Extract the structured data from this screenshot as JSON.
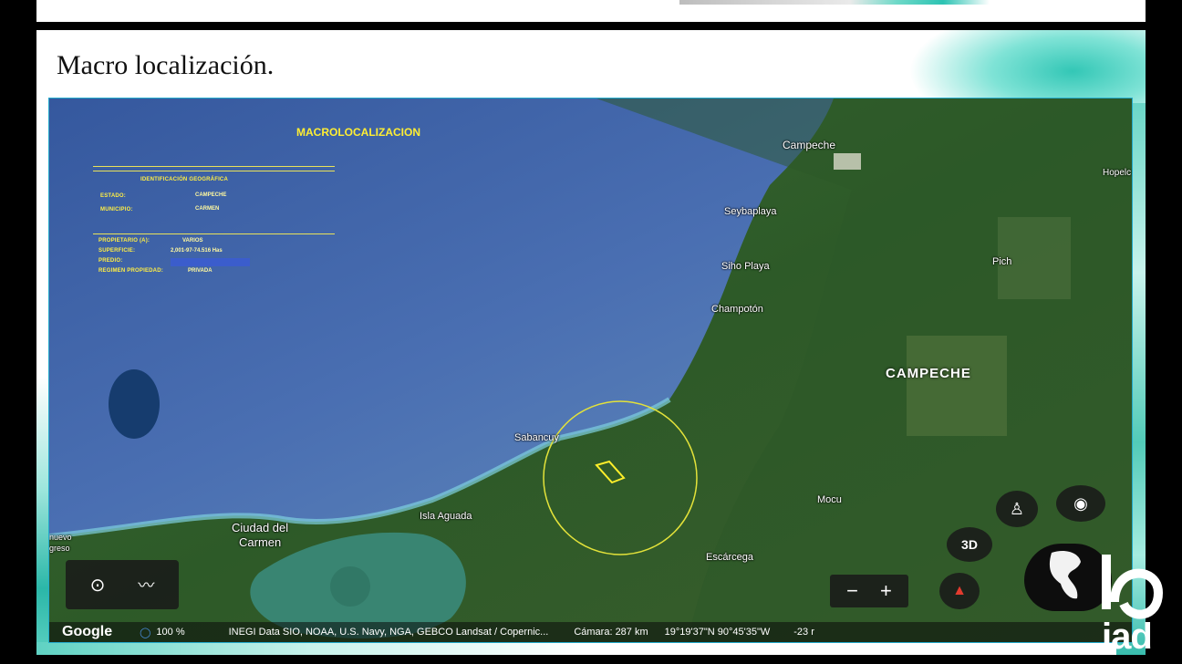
{
  "slide": {
    "title": "Macro localización."
  },
  "map": {
    "overlay": {
      "title": "MACROLOCALIZACION",
      "section": "IDENTIFICACIÓN GEOGRÁFICA",
      "estado_label": "ESTADO:",
      "estado_value": "CAMPECHE",
      "municipio_label": "MUNICIPIO:",
      "municipio_value": "CARMEN",
      "propietario_label": "PROPIETARIO (A):",
      "propietario_value": "VARIOS",
      "superficie_label": "SUPERFICIE:",
      "superficie_value": "2,001-97-74.516 Has",
      "predio_label": "PREDIO:",
      "regimen_label": "REGIMEN PROPIEDAD:",
      "regimen_value": "PRIVADA"
    },
    "places": {
      "campeche_city": "Campeche",
      "seybaplaya": "Seybaplaya",
      "sihoplaya": "Siho Playa",
      "champoton": "Champotón",
      "pich": "Pich",
      "hopelchen": "Hopelc",
      "state": "CAMPECHE",
      "sabancuy": "Sabancuy",
      "isla_aguada": "Isla Aguada",
      "ciudad_del_carmen_1": "Ciudad del",
      "ciudad_del_carmen_2": "Carmen",
      "mocu": "Mocu",
      "escarcega": "Escárcega",
      "left_edge_1": "nuevo",
      "left_edge_2": "greso"
    },
    "controls": {
      "three_d": "3D",
      "zoom_out": "−",
      "zoom_in": "+"
    },
    "status_bar": {
      "logo": "Google",
      "zoom": "100 %",
      "attribution": "INEGI  Data SIO, NOAA, U.S. Navy, NGA, GEBCO  Landsat / Copernic...",
      "camera": "Cámara: 287 km",
      "coords": "19°19'37\"N 90°45'35\"W",
      "elevation": "-23 r"
    }
  },
  "branding": {
    "logo_text": "iad"
  },
  "colors": {
    "sea": "#3f63a6",
    "land": "#2f5a2a",
    "overlay_text": "#ffee33",
    "accent_teal": "#33c7b6"
  }
}
